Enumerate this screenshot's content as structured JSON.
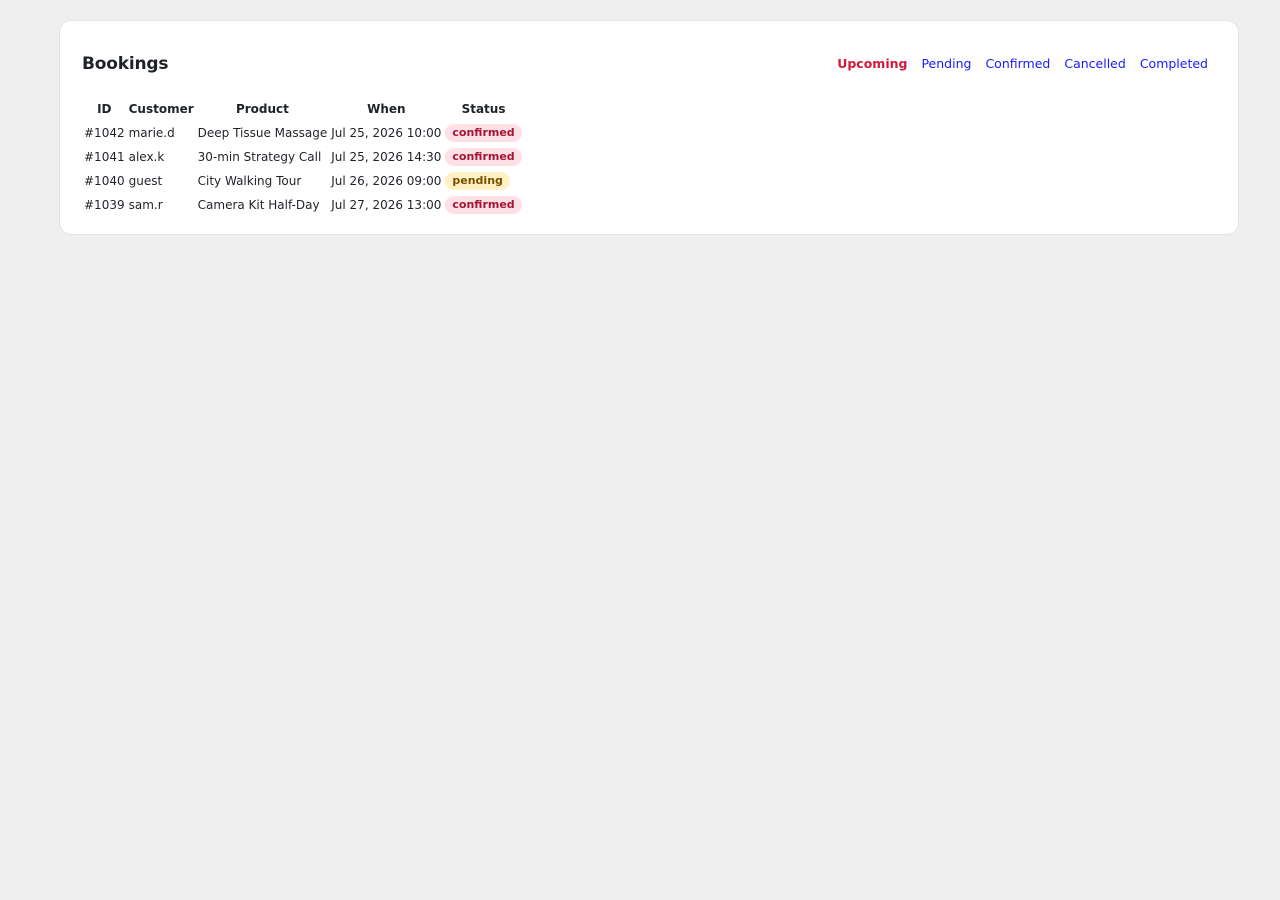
{
  "page": {
    "title": "Bookings"
  },
  "tabs": [
    {
      "label": "Upcoming",
      "active": true
    },
    {
      "label": "Pending",
      "active": false
    },
    {
      "label": "Confirmed",
      "active": false
    },
    {
      "label": "Cancelled",
      "active": false
    },
    {
      "label": "Completed",
      "active": false
    }
  ],
  "table": {
    "headers": {
      "id": "ID",
      "customer": "Customer",
      "product": "Product",
      "when": "When",
      "status": "Status"
    },
    "rows": [
      {
        "id": "#1042",
        "customer": "marie.d",
        "product": "Deep Tissue Massage",
        "when": "Jul 25, 2026 10:00",
        "status": "confirmed"
      },
      {
        "id": "#1041",
        "customer": "alex.k",
        "product": "30-min Strategy Call",
        "when": "Jul 25, 2026 14:30",
        "status": "confirmed"
      },
      {
        "id": "#1040",
        "customer": "guest",
        "product": "City Walking Tour",
        "when": "Jul 26, 2026 09:00",
        "status": "pending"
      },
      {
        "id": "#1039",
        "customer": "sam.r",
        "product": "Camera Kit Half-Day",
        "when": "Jul 27, 2026 13:00",
        "status": "confirmed"
      }
    ]
  },
  "colors": {
    "active_tab": "#d11a3a",
    "link": "#1a1aff",
    "confirmed_bg": "#ffe0e6",
    "pending_bg": "#fff1c4"
  }
}
